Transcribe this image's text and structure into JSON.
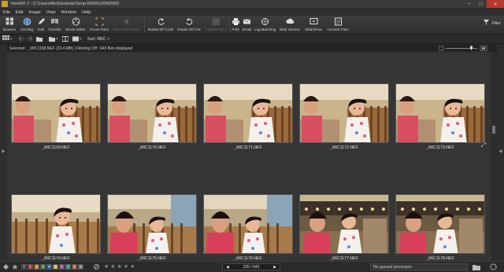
{
  "window": {
    "title": "ViewNX 2 - C:\\Users\\Mv\\Desktop\\Temp D600\\100ND600",
    "controls": [
      "minimize",
      "maximize",
      "close"
    ]
  },
  "menu": [
    "File",
    "Edit",
    "Image",
    "View",
    "Window",
    "Help"
  ],
  "toolbar": [
    {
      "label": "Browser",
      "icon": "browser-icon",
      "enabled": true
    },
    {
      "label": "GeoTag",
      "icon": "geotag-icon",
      "enabled": true
    },
    {
      "label": "Edit",
      "icon": "edit-icon",
      "enabled": true
    },
    {
      "label": "Transfer",
      "icon": "transfer-icon",
      "enabled": true
    },
    {
      "label": "Movie Editor",
      "icon": "movie-editor-icon",
      "enabled": true
    },
    {
      "label": "Focus Point",
      "icon": "focus-point-icon",
      "enabled": true
    },
    {
      "label": "Play Voice Memo",
      "icon": "voice-memo-icon",
      "enabled": false
    },
    {
      "label": "Rotate 90°CCW",
      "icon": "rotate-ccw-icon",
      "enabled": true
    },
    {
      "label": "Rotate 90°CW",
      "icon": "rotate-cw-icon",
      "enabled": true
    },
    {
      "label": "Capture NX 2",
      "icon": "capture-nx-icon",
      "enabled": false
    },
    {
      "label": "Print",
      "icon": "print-icon",
      "enabled": true
    },
    {
      "label": "Email",
      "icon": "email-icon",
      "enabled": true
    },
    {
      "label": "Log Matching",
      "icon": "log-matching-icon",
      "enabled": true
    },
    {
      "label": "Web Service",
      "icon": "web-service-icon",
      "enabled": true
    },
    {
      "label": "SlideShow",
      "icon": "slideshow-icon",
      "enabled": true
    },
    {
      "label": "Convert Files",
      "icon": "convert-files-icon",
      "enabled": true
    }
  ],
  "filter": {
    "label": "Filter"
  },
  "sort": {
    "label": "Sort: RBC"
  },
  "status": {
    "text": "Selected : _MIC1168.NEF (23.4 MB) | Filtering Off : 643 files displayed"
  },
  "thumbnails": [
    {
      "name": "_MIC1169.NEF",
      "scene": "A"
    },
    {
      "name": "_MIC1170.NEF",
      "scene": "A"
    },
    {
      "name": "_MIC1171.NEF",
      "scene": "A"
    },
    {
      "name": "_MIC1172.NEF",
      "scene": "A"
    },
    {
      "name": "_MIC1173.NEF",
      "scene": "A"
    },
    {
      "name": "_MIC1174.NEF",
      "scene": "B"
    },
    {
      "name": "_MIC1175.NEF",
      "scene": "C"
    },
    {
      "name": "_MIC1176.NEF",
      "scene": "C"
    },
    {
      "name": "_MIC1177.NEF",
      "scene": "D"
    },
    {
      "name": "_MIC1178.NEF",
      "scene": "D"
    }
  ],
  "bottom": {
    "labels": [
      "0",
      "1",
      "2",
      "3",
      "4",
      "5",
      "6",
      "7",
      "8",
      "9"
    ],
    "label_colors": [
      "#2a2a2a",
      "#b03030",
      "#c07a20",
      "#3a7a30",
      "#2a5a9a",
      "#c0b020",
      "#8a3a9a",
      "#2a8a8a",
      "#a05030",
      "#666666"
    ],
    "rating_stars": 5,
    "pager_text": "220 / 643",
    "queue_text": "No queued processes"
  }
}
